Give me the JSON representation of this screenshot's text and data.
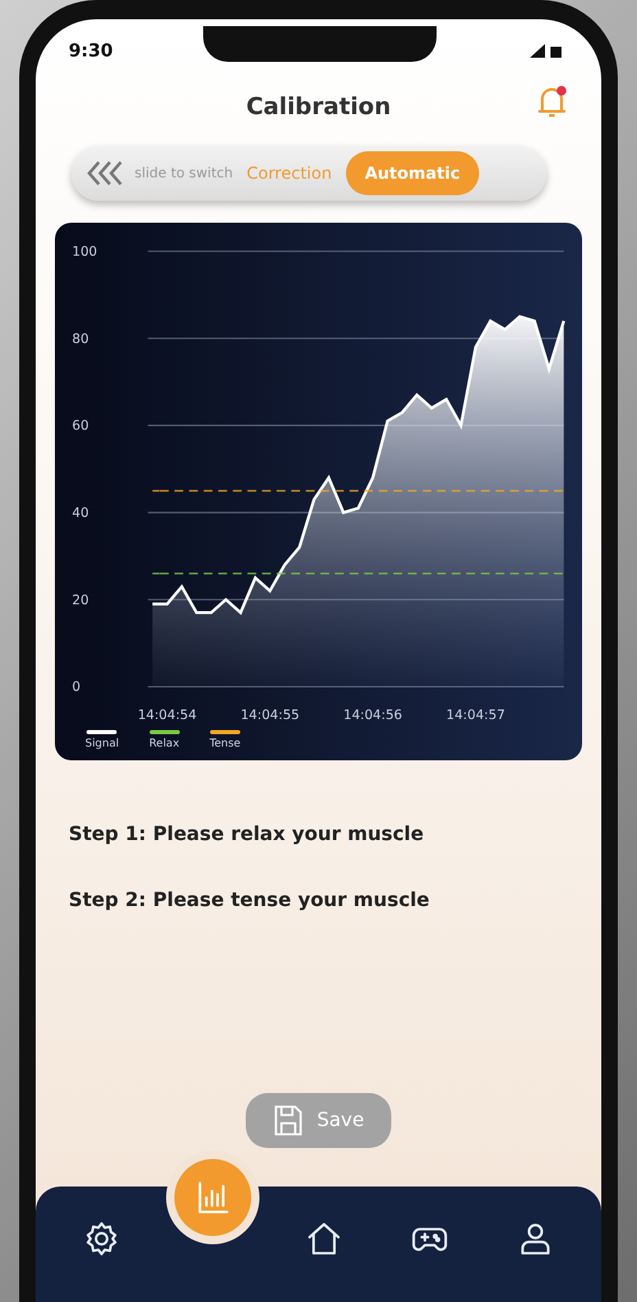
{
  "status_bar": {
    "time": "9:30"
  },
  "header": {
    "title": "Calibration",
    "notification": true
  },
  "mode_switch": {
    "hint": "slide to switch",
    "options": [
      {
        "label": "Correction",
        "selected": false
      },
      {
        "label": "Automatic",
        "selected": true
      }
    ]
  },
  "chart": {
    "chart_data": {
      "type": "area",
      "grid": "y",
      "legend": "bottom-left",
      "categories": [
        null,
        "14:04:54",
        null,
        null,
        null,
        null,
        null,
        null,
        "14:04:55",
        null,
        null,
        null,
        null,
        null,
        null,
        "14:04:56",
        null,
        null,
        null,
        null,
        null,
        null,
        "14:04:57",
        null,
        null,
        null,
        null,
        null,
        null
      ],
      "series": [
        {
          "name": "Signal",
          "type": "area",
          "color": "#ffffff",
          "values": [
            19,
            19,
            23,
            17,
            17,
            20,
            17,
            25,
            22,
            28,
            32,
            43,
            48,
            40,
            41,
            48,
            61,
            63,
            67,
            64,
            66,
            60,
            78,
            84,
            82,
            85,
            84,
            73,
            84
          ]
        },
        {
          "name": "Relax",
          "type": "line",
          "line_style": "dashed",
          "color": "#7ac943",
          "values": [
            26,
            26,
            26,
            26,
            26,
            26,
            26,
            26,
            26,
            26,
            26,
            26,
            26,
            26,
            26,
            26,
            26,
            26,
            26,
            26,
            26,
            26,
            26,
            26,
            26,
            26,
            26,
            26,
            26
          ]
        },
        {
          "name": "Tense",
          "type": "line",
          "line_style": "dashed",
          "color": "#f5a623",
          "values": [
            45,
            45,
            45,
            45,
            45,
            45,
            45,
            45,
            45,
            45,
            45,
            45,
            45,
            45,
            45,
            45,
            45,
            45,
            45,
            45,
            45,
            45,
            45,
            45,
            45,
            45,
            45,
            45,
            45
          ]
        }
      ],
      "ylim": [
        0,
        100
      ],
      "yticks": [
        0,
        20,
        40,
        60,
        80,
        100
      ]
    }
  },
  "steps": [
    "Step 1: Please relax your muscle",
    "Step 2: Please tense your muscle"
  ],
  "save_button": {
    "label": "Save",
    "disabled": true
  },
  "nav": [
    {
      "kind": "settings",
      "selected": false
    },
    {
      "kind": "chart",
      "selected": true
    },
    {
      "kind": "home",
      "selected": false
    },
    {
      "kind": "games",
      "selected": false
    },
    {
      "kind": "profile",
      "selected": false
    }
  ]
}
